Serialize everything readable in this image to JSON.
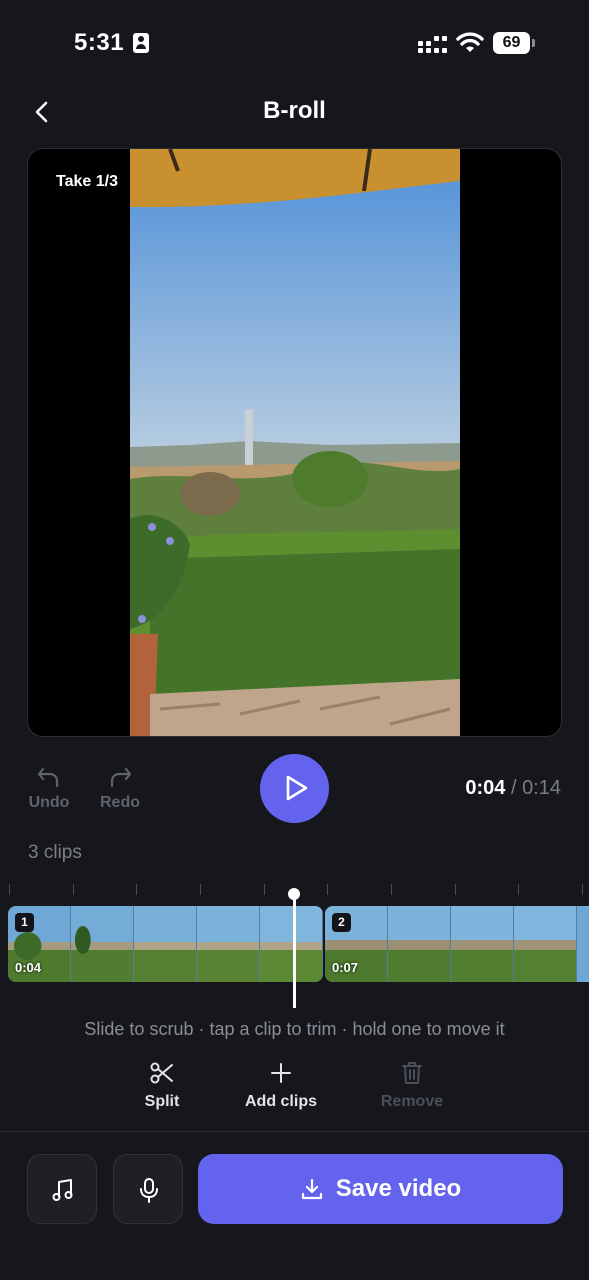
{
  "status_bar": {
    "time": "5:31",
    "battery": "69"
  },
  "header": {
    "title": "B-roll"
  },
  "preview": {
    "take_label": "Take 1/3"
  },
  "controls": {
    "undo_label": "Undo",
    "redo_label": "Redo",
    "time_current": "0:04",
    "time_separator": "/",
    "time_total": "0:14"
  },
  "timeline": {
    "clips_count": "3 clips",
    "clips": [
      {
        "index": "1",
        "duration": "0:04"
      },
      {
        "index": "2",
        "duration": "0:07"
      }
    ],
    "hint": "Slide to scrub · tap a clip to trim · hold one to move it"
  },
  "tools": {
    "split_label": "Split",
    "add_label": "Add clips",
    "remove_label": "Remove"
  },
  "bottom_bar": {
    "save_label": "Save video"
  },
  "colors": {
    "accent": "#6463ee",
    "background": "#16171d"
  }
}
